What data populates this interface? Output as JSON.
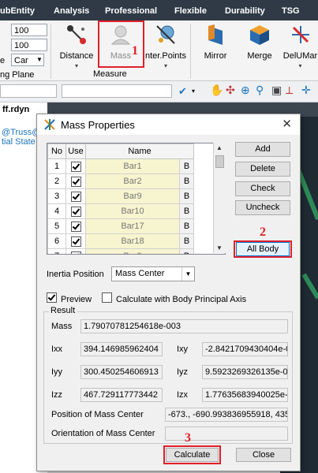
{
  "menu": [
    "ubEntity",
    "Analysis",
    "Professional",
    "Flexible",
    "Durability",
    "TSG"
  ],
  "ribbon": {
    "field1": "100",
    "field2": "100",
    "field3": "Car",
    "field3_prefix": "e",
    "group_label_left": "ng Plane",
    "buttons": {
      "distance": "Distance",
      "mass": "Mass",
      "center_points": "nter.Points",
      "mirror": "Mirror",
      "merge": "Merge",
      "delumar": "DelUMar"
    },
    "group_measure": "Measure"
  },
  "tab": "ff.rdyn",
  "left_panel": [
    "@Truss@",
    "tial State"
  ],
  "annotations": [
    "1",
    "2",
    "3"
  ],
  "dialog": {
    "title": "Mass Properties",
    "close_glyph": "✕",
    "columns": [
      "No",
      "Use",
      "Name"
    ],
    "rows": [
      {
        "no": "1",
        "name": "Bar1",
        "b": "B"
      },
      {
        "no": "2",
        "name": "Bar2",
        "b": "B"
      },
      {
        "no": "3",
        "name": "Bar9",
        "b": "B"
      },
      {
        "no": "4",
        "name": "Bar10",
        "b": "B"
      },
      {
        "no": "5",
        "name": "Bar17",
        "b": "B"
      },
      {
        "no": "6",
        "name": "Bar18",
        "b": "B"
      },
      {
        "no": "7",
        "name": "Bar3",
        "b": "B"
      }
    ],
    "buttons": {
      "add": "Add",
      "delete": "Delete",
      "check": "Check",
      "uncheck": "Uncheck",
      "all_body": "All Body",
      "calculate": "Calculate",
      "close": "Close"
    },
    "inertia_position_label": "Inertia Position",
    "inertia_position_value": "Mass Center",
    "preview_label": "Preview",
    "principal_axis_label": "Calculate with Body Principal Axis",
    "result": {
      "caption": "Result",
      "mass_label": "Mass",
      "mass": "1.79070781254618e-003",
      "ixx_label": "Ixx",
      "ixx": "394.146985962404",
      "ixy_label": "Ixy",
      "ixy": "-2.8421709430404e-0",
      "iyy_label": "Iyy",
      "iyy": "300.450254606913",
      "iyz_label": "Iyz",
      "iyz": "9.5923269326135e-0",
      "izz_label": "Izz",
      "izz": "467.729117773442",
      "izx_label": "Izx",
      "izx": "1.77635683940025e-0",
      "pos_label": "Position of Mass Center",
      "pos": "-673., -690.993836955918, 435.1",
      "orient_label": "Orientation of Mass Center",
      "orient": ""
    }
  },
  "colors": {
    "highlight": "#e0202a",
    "title_bar": "#2f3a46",
    "name_cell": "#f7f5cf"
  }
}
